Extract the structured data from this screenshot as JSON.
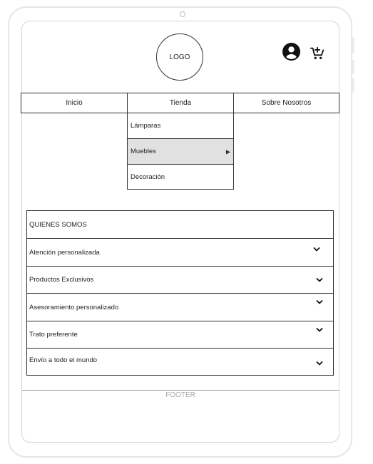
{
  "header": {
    "logo_text": "LOGO",
    "account_icon": "user-circle-icon",
    "cart_icon": "cart-add-icon"
  },
  "nav": {
    "items": [
      {
        "label": "Inicio"
      },
      {
        "label": "Tienda"
      },
      {
        "label": "Sobre Nosotros"
      }
    ]
  },
  "dropdown": {
    "items": [
      {
        "label": "Lámparas"
      },
      {
        "label": "Muebles",
        "submenu_icon": "triangle-right-icon"
      },
      {
        "label": "Decoración"
      }
    ],
    "highlight_color": "#e1e1e1"
  },
  "accordion": {
    "title": "QUIENES SOMOS",
    "items": [
      {
        "label": "Atención personalizada"
      },
      {
        "label": "Productos Exclusivos"
      },
      {
        "label": "Asesoramiento personalizado"
      },
      {
        "label": "Trato preferente"
      },
      {
        "label": "Envío a todo el mundo"
      }
    ],
    "toggle_icon": "chevron-down-icon"
  },
  "footer": {
    "text": "FOOTER"
  }
}
